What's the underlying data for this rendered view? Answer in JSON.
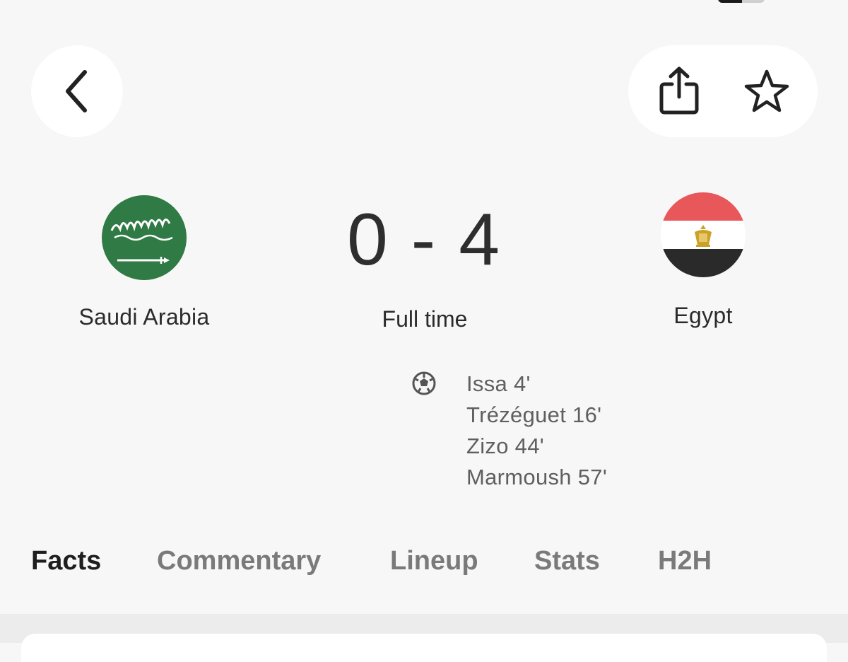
{
  "header": {
    "back_icon": "chevron-left-icon",
    "share_icon": "share-icon",
    "favorite_icon": "star-outline-icon"
  },
  "match": {
    "home_team": {
      "name": "Saudi Arabia",
      "flag_colors": {
        "field": "#2f7a45",
        "detail": "#ffffff"
      }
    },
    "away_team": {
      "name": "Egypt",
      "flag_colors": {
        "top": "#e8575a",
        "middle": "#ffffff",
        "bottom": "#2a2a2a",
        "emblem": "#c9a227"
      }
    },
    "score": "0 - 4",
    "status": "Full time",
    "goal_icon": "soccer-ball-icon",
    "scorers": [
      "Issa 4'",
      "Trézéguet 16'",
      "Zizo 44'",
      "Marmoush 57'"
    ]
  },
  "tabs": [
    {
      "label": "Facts",
      "active": true
    },
    {
      "label": "Commentary",
      "active": false
    },
    {
      "label": "Lineup",
      "active": false
    },
    {
      "label": "Stats",
      "active": false
    },
    {
      "label": "H2H",
      "active": false
    }
  ],
  "colors": {
    "background": "#f7f7f7",
    "active_tab": "#1e1e1e",
    "inactive_tab": "#7a7a7a"
  }
}
